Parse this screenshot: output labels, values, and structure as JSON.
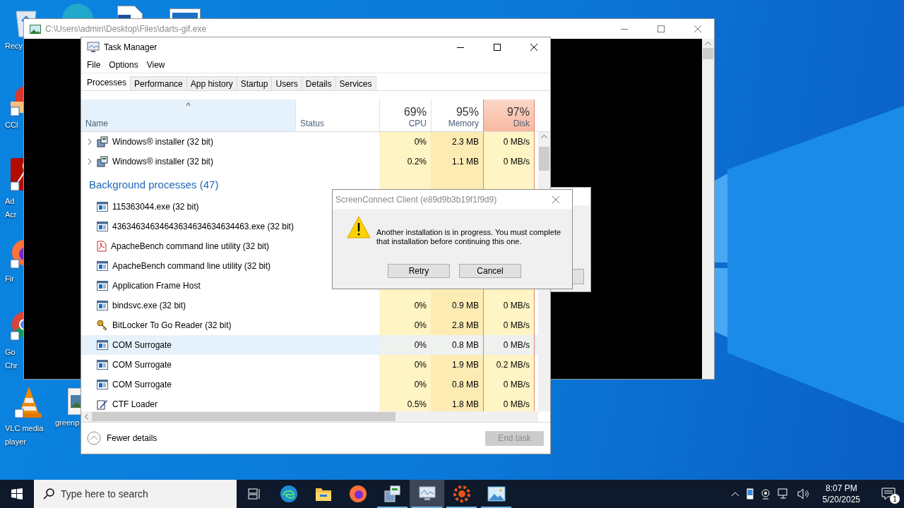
{
  "desktop": {
    "icons": [
      {
        "kind": "recycle",
        "lines": [
          "Recy"
        ]
      },
      {
        "kind": "cleaner",
        "lines": [
          "CCl"
        ]
      },
      {
        "kind": "acrobat",
        "lines": [
          "Ad",
          "Acr"
        ]
      },
      {
        "kind": "firefox",
        "lines": [
          "Fir"
        ]
      },
      {
        "kind": "chrome",
        "lines": [
          "Go",
          "Chr"
        ]
      },
      {
        "kind": "vlc",
        "lines": [
          "VLC media",
          "player"
        ]
      },
      {
        "kind": "image",
        "lines": [
          "greenp"
        ]
      },
      {
        "kind": "edge"
      },
      {
        "kind": "document"
      },
      {
        "kind": "window"
      }
    ]
  },
  "background_window": {
    "title": "C:\\Users\\admin\\Desktop\\Files\\darts-gif.exe"
  },
  "task_manager": {
    "title": "Task Manager",
    "menu": [
      "File",
      "Options",
      "View"
    ],
    "tabs": [
      {
        "label": "Processes",
        "selected": true
      },
      {
        "label": "Performance",
        "selected": false
      },
      {
        "label": "App history",
        "selected": false
      },
      {
        "label": "Startup",
        "selected": false
      },
      {
        "label": "Users",
        "selected": false
      },
      {
        "label": "Details",
        "selected": false
      },
      {
        "label": "Services",
        "selected": false
      }
    ],
    "sort_indicator": "^",
    "columns": [
      {
        "label": "Name",
        "highlighted": false
      },
      {
        "label": "Status",
        "highlighted": false
      },
      {
        "label": "CPU",
        "usage": "69%",
        "highlighted": false
      },
      {
        "label": "Memory",
        "usage": "95%",
        "highlighted": false
      },
      {
        "label": "Disk",
        "usage": "97%",
        "highlighted": true
      }
    ],
    "rows": [
      {
        "kind": "app",
        "name": "Windows® installer (32 bit)",
        "expanded": false,
        "selected": false,
        "cpu": "0%",
        "memory": "2.3 MB",
        "disk": "0 MB/s"
      },
      {
        "kind": "app",
        "name": "Windows® installer (32 bit)",
        "expanded": false,
        "selected": false,
        "cpu": "0.2%",
        "memory": "1.1 MB",
        "disk": "0 MB/s"
      },
      {
        "kind": "group",
        "name": "Background processes (47)"
      },
      {
        "kind": "process",
        "name": "115363044.exe (32 bit)",
        "selected": false
      },
      {
        "kind": "process",
        "name": "43634634634643634634634634463.exe (32 bit)",
        "selected": false
      },
      {
        "kind": "process",
        "name": "ApacheBench command line utility (32 bit)",
        "selected": false
      },
      {
        "kind": "process",
        "name": "ApacheBench command line utility (32 bit)",
        "selected": false
      },
      {
        "kind": "process",
        "name": "Application Frame Host",
        "selected": false
      },
      {
        "kind": "process",
        "name": "bindsvc.exe (32 bit)",
        "selected": false,
        "cpu": "0%",
        "memory": "0.9 MB",
        "disk": "0 MB/s"
      },
      {
        "kind": "process",
        "name": "BitLocker To Go Reader (32 bit)",
        "selected": false,
        "cpu": "0%",
        "memory": "2.8 MB",
        "disk": "0 MB/s"
      },
      {
        "kind": "process",
        "name": "COM Surrogate",
        "selected": true,
        "cpu": "0%",
        "memory": "0.8 MB",
        "disk": "0 MB/s"
      },
      {
        "kind": "process",
        "name": "COM Surrogate",
        "selected": false,
        "cpu": "0%",
        "memory": "1.9 MB",
        "disk": "0.2 MB/s"
      },
      {
        "kind": "process",
        "name": "COM Surrogate",
        "selected": false,
        "cpu": "0%",
        "memory": "0.8 MB",
        "disk": "0 MB/s"
      },
      {
        "kind": "process",
        "name": "CTF Loader",
        "selected": false,
        "cpu": "0.5%",
        "memory": "1.8 MB",
        "disk": "0 MB/s"
      }
    ],
    "footer": {
      "toggle": "Fewer details",
      "button": {
        "label": "End task",
        "disabled": true
      }
    }
  },
  "dialog": {
    "title": "ScreenConnect Client (e89d9b3b19f1f9d9)",
    "message": "Another installation is in progress. You must complete that installation before continuing this one.",
    "buttons": [
      "Retry",
      "Cancel"
    ]
  },
  "taskbar": {
    "search_placeholder": "Type here to search",
    "apps": [
      {
        "kind": "taskview",
        "running": false,
        "selected": false
      },
      {
        "kind": "edge",
        "running": false,
        "selected": false
      },
      {
        "kind": "explorer",
        "running": false,
        "selected": false
      },
      {
        "kind": "firefox",
        "running": false,
        "selected": false
      },
      {
        "kind": "installer",
        "running": true,
        "selected": false
      },
      {
        "kind": "taskmgr",
        "running": true,
        "selected": true
      },
      {
        "kind": "gear",
        "running": true,
        "selected": false
      },
      {
        "kind": "photos",
        "running": true,
        "selected": false
      }
    ],
    "time": "8:07 PM",
    "date": "5/20/2025",
    "notifications": "1"
  }
}
